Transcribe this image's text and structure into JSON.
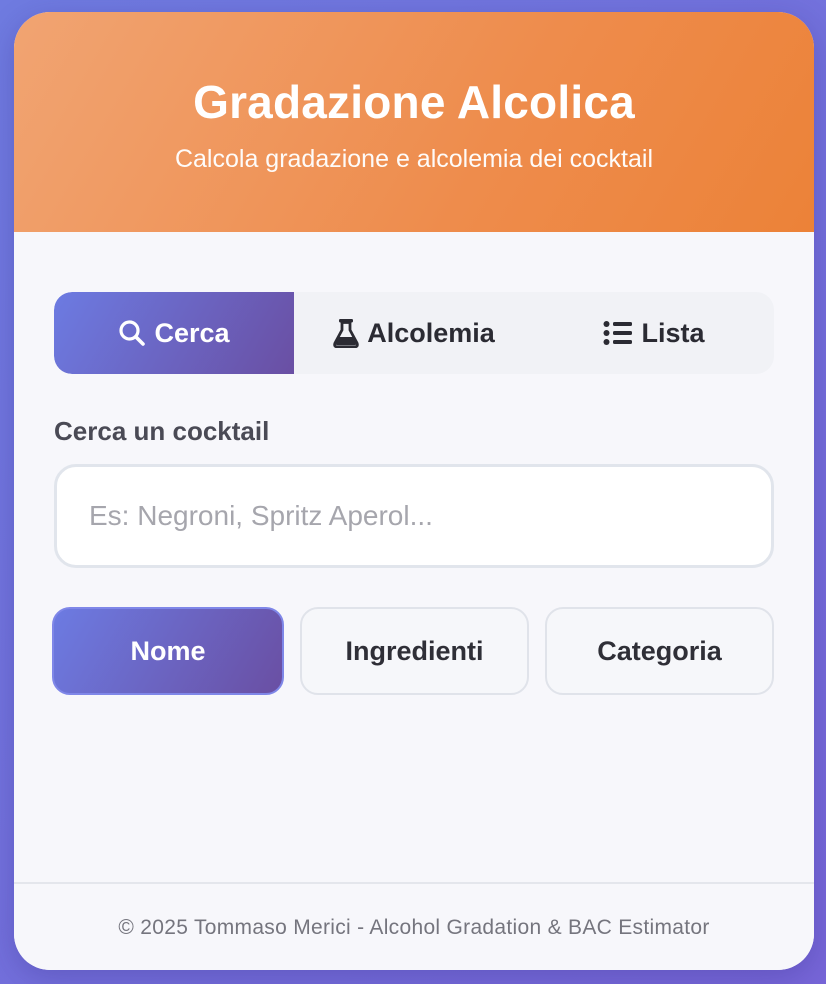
{
  "header": {
    "title": "Gradazione Alcolica",
    "subtitle": "Calcola gradazione e alcolemia dei cocktail",
    "gradient_start": "#f1a472",
    "gradient_end": "#ec8238"
  },
  "tabs": [
    {
      "label": "Cerca",
      "icon": "search-icon",
      "active": true
    },
    {
      "label": "Alcolemia",
      "icon": "flask-icon",
      "active": false
    },
    {
      "label": "Lista",
      "icon": "list-icon",
      "active": false
    }
  ],
  "search": {
    "label": "Cerca un cocktail",
    "placeholder": "Es: Negroni, Spritz Aperol...",
    "value": ""
  },
  "filters": [
    {
      "label": "Nome",
      "active": true
    },
    {
      "label": "Ingredienti",
      "active": false
    },
    {
      "label": "Categoria",
      "active": false
    }
  ],
  "footer": {
    "text": "© 2025 Tommaso Merici - Alcohol Gradation & BAC Estimator"
  },
  "colors": {
    "accent_gradient_start": "#6c7be2",
    "accent_gradient_end": "#6a4fa3",
    "page_background": "#6f7be0"
  }
}
